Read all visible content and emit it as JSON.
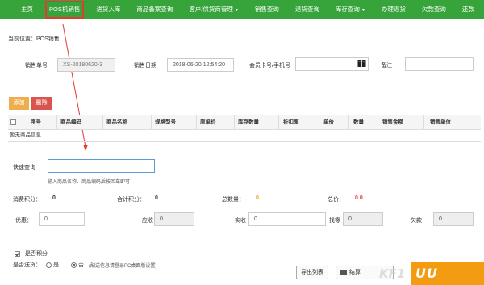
{
  "nav": {
    "items": [
      {
        "label": "主页"
      },
      {
        "label": "POS机销售",
        "active": true
      },
      {
        "label": "进货入库"
      },
      {
        "label": "商品备案查询"
      },
      {
        "label": "客户/供货商管理",
        "caret": "▼"
      },
      {
        "label": "销售查询"
      },
      {
        "label": "退货查询"
      },
      {
        "label": "库存查询",
        "caret": "▼"
      },
      {
        "label": "办理退货"
      },
      {
        "label": "欠款查询"
      },
      {
        "label": "还款"
      }
    ]
  },
  "breadcrumb": "当前位置：POS销售",
  "form": {
    "sale_no_label": "销售单号",
    "sale_no_value": "XS-20180620-3",
    "sale_date_label": "销售日期",
    "sale_date_value": "2018-06-20 12:54:20",
    "member_label": "会员卡号/手机号",
    "member_value": "",
    "remark_label": "备注",
    "remark_value": ""
  },
  "buttons": {
    "add": "添加",
    "delete": "删除",
    "export": "导出列表",
    "checkout": "结算"
  },
  "table": {
    "columns": [
      "序号",
      "商品编码",
      "商品名称",
      "规格型号",
      "原单价",
      "库存数量",
      "折扣率",
      "单价",
      "数量",
      "销售金额",
      "销售单位"
    ],
    "empty_text": "暂无商品信息"
  },
  "quick_search": {
    "label": "快速查询",
    "value": "",
    "hint": "输入商品名称、商品编码后按回车即可"
  },
  "summary": {
    "points_label": "消费积分：",
    "points_value": "0",
    "total_points_label": "合计积分：",
    "total_points_value": "0",
    "total_qty_label": "总数量：",
    "total_qty_value": "0",
    "total_price_label": "总价：",
    "total_price_value": "0.0"
  },
  "payment": {
    "discount_label": "优惠：",
    "discount_value": "0",
    "receivable_label": "应收",
    "receivable_value": "0",
    "received_label": "实收",
    "received_value": "0",
    "change_label": "找零",
    "change_value": "0",
    "owed_label": "欠款",
    "owed_value": "0"
  },
  "options": {
    "use_points_label": "是否积分",
    "delivery_label": "是否送货：",
    "option_yes": "是",
    "option_no": "否",
    "delivery_note": "(配送信息请登录PC桌面版设置)"
  },
  "watermark": {
    "orange_text": "UU",
    "ghost_text": "KF1"
  },
  "colors": {
    "nav_bg": "#36a33b",
    "add_btn": "#f0ad4e",
    "delete_btn": "#d9534f",
    "qty_value": "#f0a020",
    "price_value": "#e53935",
    "highlight": "#e53935"
  }
}
